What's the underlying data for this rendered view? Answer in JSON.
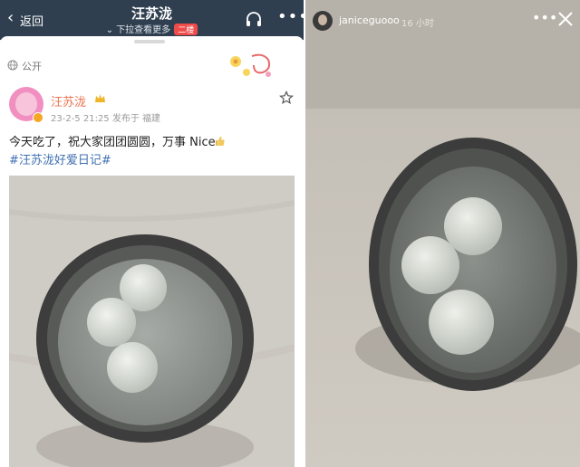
{
  "weibo": {
    "nav": {
      "back_label": "返回",
      "title": "汪苏泷",
      "subtitle": "下拉查看更多",
      "badge": "二楼"
    },
    "post": {
      "visibility": "公开",
      "username": "汪苏泷",
      "meta": "23-2-5 21:25  发布于 福建",
      "text": "今天吃了，祝大家团团圆圆，万事 Nice",
      "hashtag": "#汪苏泷好爱日记#"
    }
  },
  "instagram_story": {
    "username": "janiceguooo",
    "time": "16 小时"
  },
  "icons": {
    "back": "chevron-left-icon",
    "listen": "headphones-icon",
    "more": "more-dots-icon",
    "visibility": "globe-icon",
    "star": "star-outline-icon",
    "close": "close-icon",
    "thumb": "thumbs-up-emoji"
  },
  "colors": {
    "nav_bar": "#2f3f50",
    "username": "#eb7350",
    "hashtag": "#3f6fb0",
    "badge": "#f04b4b"
  }
}
